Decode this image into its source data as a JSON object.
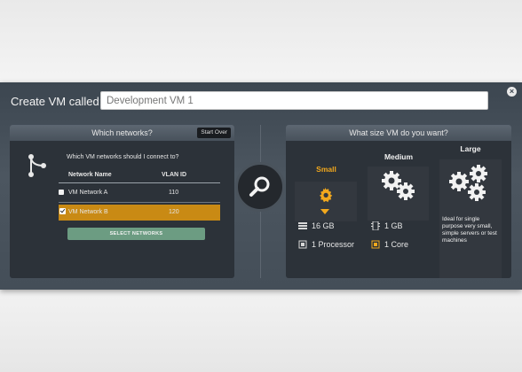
{
  "dialog": {
    "label": "Create VM called:",
    "vm_name": "Development VM 1",
    "close_icon": "×"
  },
  "networks": {
    "header": "Which networks?",
    "start_over": "Start Over",
    "question": "Which VM networks should I connect to?",
    "columns": [
      "Network Name",
      "VLAN ID"
    ],
    "rows": [
      {
        "name": "VM Network A",
        "vlan": "110",
        "selected": false
      },
      {
        "name": "VM Network B",
        "vlan": "120",
        "selected": true
      }
    ],
    "select_button": "SELECT NETWORKS"
  },
  "sizes": {
    "header": "What size VM do you want?",
    "small": {
      "label": "Small",
      "memory": "16 GB",
      "cpu": "1 Processor"
    },
    "medium": {
      "label": "Medium",
      "memory": "1 GB",
      "cpu": "1 Core"
    },
    "large": {
      "label": "Large",
      "description": "Ideal for single purpose very small, simple servers or test machines"
    }
  },
  "colors": {
    "accent": "#f2a81d",
    "selected_row": "#c98a14",
    "select_button": "#6c9c82",
    "panel": "#2c3239"
  },
  "icons": [
    "close-icon",
    "branch-icon",
    "search-icon",
    "gear-icon",
    "gears-icon",
    "memory-icon",
    "cpu-icon"
  ]
}
